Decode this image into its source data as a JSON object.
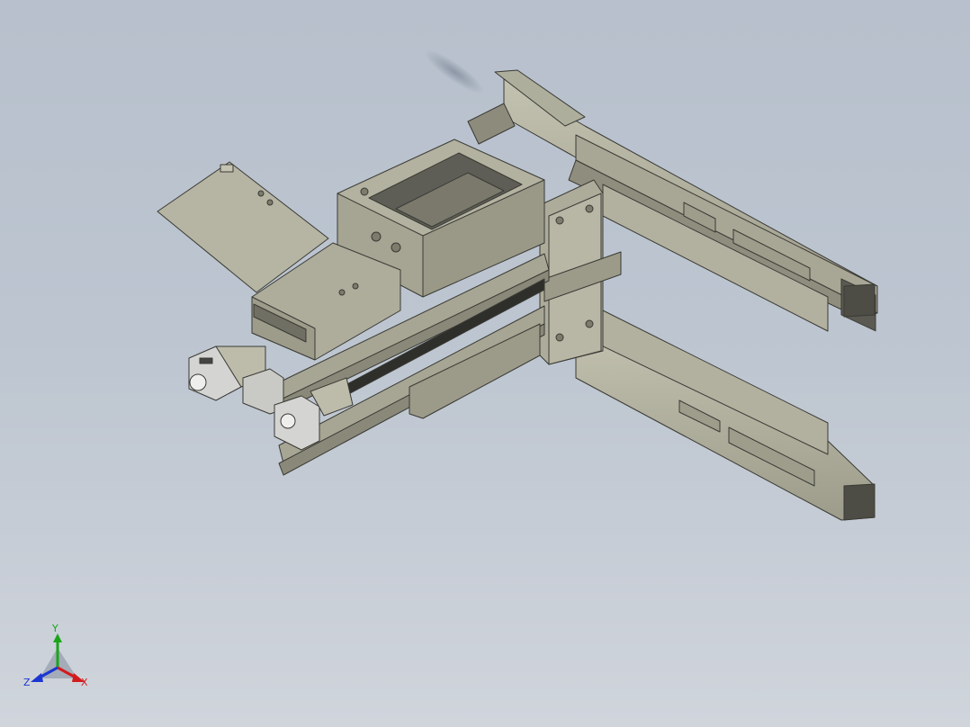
{
  "viewport": {
    "background_top": "#b7c0cc",
    "background_bottom": "#d0d5dc",
    "part_color": "#b9b8a6",
    "part_shadow": "#8f8e7e",
    "edge_color": "#3a3a35",
    "motor_color": "#d8d8d8"
  },
  "triad": {
    "x_label": "X",
    "y_label": "Y",
    "z_label": "Z",
    "x_color": "#d21c1c",
    "y_color": "#1aa51a",
    "z_color": "#1c36d2"
  }
}
